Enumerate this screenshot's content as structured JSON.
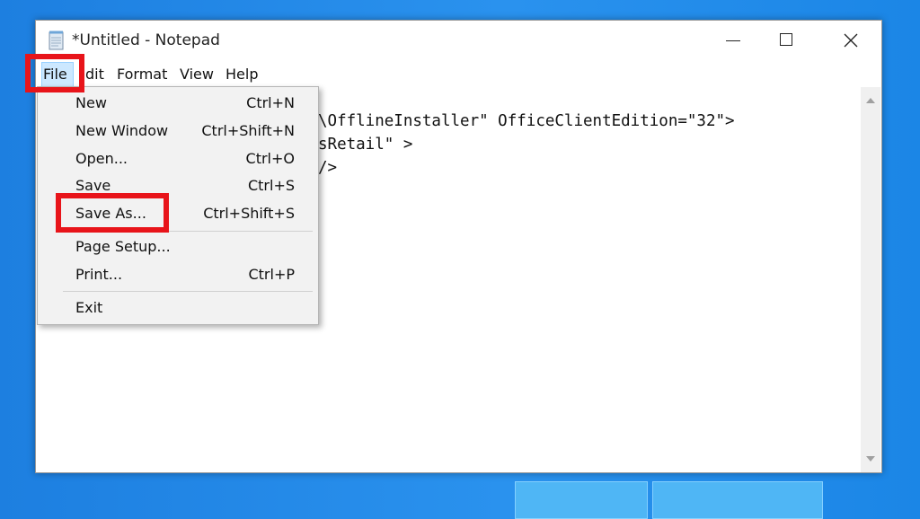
{
  "window": {
    "title": "*Untitled - Notepad"
  },
  "menubar": {
    "items": [
      "File",
      "dit",
      "Format",
      "View",
      "Help"
    ]
  },
  "editor": {
    "lines": [
      "\\OfflineInstaller\" OfficeClientEdition=\"32\">",
      "sRetail\" >",
      "/>"
    ]
  },
  "file_menu": {
    "items": [
      {
        "label": "New",
        "shortcut": "Ctrl+N"
      },
      {
        "label": "New Window",
        "shortcut": "Ctrl+Shift+N"
      },
      {
        "label": "Open...",
        "shortcut": "Ctrl+O"
      },
      {
        "label": "Save",
        "shortcut": "Ctrl+S"
      },
      {
        "label": "Save As...",
        "shortcut": "Ctrl+Shift+S"
      },
      {
        "label": "Page Setup...",
        "shortcut": ""
      },
      {
        "label": "Print...",
        "shortcut": "Ctrl+P"
      },
      {
        "label": "Exit",
        "shortcut": ""
      }
    ]
  },
  "colors": {
    "highlight": "#e8141a",
    "desktop": "#1d7fe0",
    "menu_hover": "#cce8ff"
  },
  "icons": {
    "app": "notepad-icon",
    "minimize": "minimize-icon",
    "maximize": "maximize-icon",
    "close": "close-icon"
  }
}
